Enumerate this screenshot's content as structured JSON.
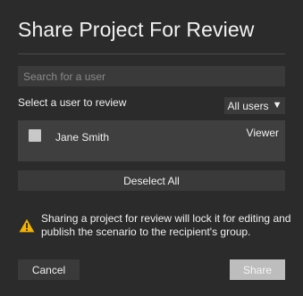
{
  "dialog": {
    "title": "Share Project For Review"
  },
  "search": {
    "placeholder": "Search for a user",
    "value": ""
  },
  "select_label": "Select a user to review",
  "filter": {
    "selected": "All users",
    "icon": "caret-down-icon"
  },
  "users": [
    {
      "name": "Jane Smith",
      "role": "Viewer",
      "checked": false
    }
  ],
  "deselect_label": "Deselect All",
  "warning": {
    "icon": "warning-icon",
    "text": "Sharing a project for review will lock it for editing and publish the scenario to the recipient's group."
  },
  "actions": {
    "cancel_label": "Cancel",
    "share_label": "Share"
  },
  "colors": {
    "background": "#2b2b2b",
    "field": "#3a3a3a",
    "list_row": "#3f3f3f",
    "warning": "#f5b400",
    "share_button": "#bdbdbd"
  }
}
